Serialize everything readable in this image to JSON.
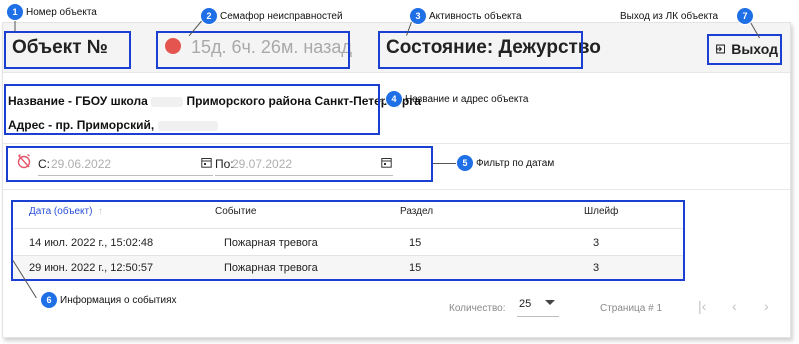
{
  "callouts": [
    {
      "num": "1",
      "label": "Номер объекта"
    },
    {
      "num": "2",
      "label": "Семафор неисправностей"
    },
    {
      "num": "3",
      "label": "Активность объекта"
    },
    {
      "num": "4",
      "label": "Название и адрес объекта"
    },
    {
      "num": "5",
      "label": "Фильтр по датам"
    },
    {
      "num": "6",
      "label": "Информация о событиях"
    },
    {
      "num": "7",
      "label": "Выход из ЛК объекта"
    }
  ],
  "header": {
    "object_number": "Объект №",
    "semaphore_text": "15д. 6ч. 26м. назад",
    "state": "Состояние: Дежурство",
    "exit_label": "Выход"
  },
  "object_info": {
    "name_prefix": "Название - ГБОУ школа",
    "name_suffix": "Приморского района Санкт-Петербурга",
    "address": "Адрес - пр. Приморский,"
  },
  "filter": {
    "from_label": "С:",
    "from_value": "29.06.2022",
    "to_label": "По:",
    "to_value": "29.07.2022"
  },
  "table": {
    "columns": [
      "Дата (объект)",
      "Событие",
      "Раздел",
      "Шлейф"
    ],
    "rows": [
      [
        "14 июл. 2022 г., 15:02:48",
        "Пожарная тревога",
        "15",
        "3"
      ],
      [
        "29 июн. 2022 г., 12:50:57",
        "Пожарная тревога",
        "15",
        "3"
      ]
    ]
  },
  "pager": {
    "count_label": "Количество:",
    "count_value": "25",
    "page_label": "Страница # 1"
  },
  "colors": {
    "callout_border": "#1a3fd1",
    "badge": "#1f6fe6",
    "semaphore": "#e4554f",
    "sort_header": "#2b4fd9"
  }
}
